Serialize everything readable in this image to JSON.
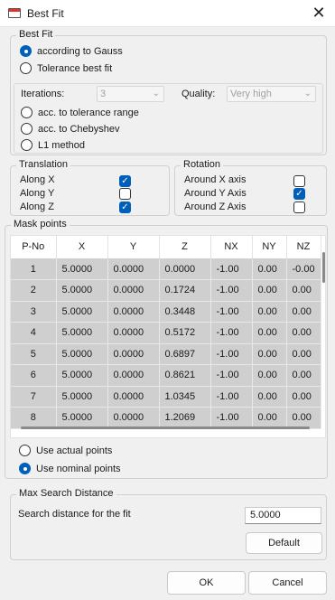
{
  "window": {
    "title": "Best Fit",
    "close_glyph": "✕"
  },
  "best_fit": {
    "label": "Best Fit",
    "gauss": "according to Gauss",
    "tolerance": "Tolerance best fit",
    "iterations_label": "Iterations:",
    "iterations_value": "3",
    "quality_label": "Quality:",
    "quality_value": "Very high",
    "tol_range": "acc. to tolerance range",
    "chebyshev": "acc. to Chebyshev",
    "l1": "L1 method",
    "selected": "according to Gauss"
  },
  "translation": {
    "label": "Translation",
    "items": [
      {
        "label": "Along X",
        "checked": true
      },
      {
        "label": "Along Y",
        "checked": false
      },
      {
        "label": "Along Z",
        "checked": true
      }
    ]
  },
  "rotation": {
    "label": "Rotation",
    "items": [
      {
        "label": "Around X axis",
        "checked": false
      },
      {
        "label": "Around Y Axis",
        "checked": true
      },
      {
        "label": "Around Z Axis",
        "checked": false
      }
    ]
  },
  "mask": {
    "label": "Mask points",
    "columns": [
      "P-No",
      "X",
      "Y",
      "Z",
      "NX",
      "NY",
      "NZ"
    ],
    "rows": [
      [
        "1",
        "5.0000",
        "0.0000",
        "0.0000",
        "-1.00",
        "0.00",
        "-0.00"
      ],
      [
        "2",
        "5.0000",
        "0.0000",
        "0.1724",
        "-1.00",
        "0.00",
        "0.00"
      ],
      [
        "3",
        "5.0000",
        "0.0000",
        "0.3448",
        "-1.00",
        "0.00",
        "0.00"
      ],
      [
        "4",
        "5.0000",
        "0.0000",
        "0.5172",
        "-1.00",
        "0.00",
        "0.00"
      ],
      [
        "5",
        "5.0000",
        "0.0000",
        "0.6897",
        "-1.00",
        "0.00",
        "0.00"
      ],
      [
        "6",
        "5.0000",
        "0.0000",
        "0.8621",
        "-1.00",
        "0.00",
        "0.00"
      ],
      [
        "7",
        "5.0000",
        "0.0000",
        "1.0345",
        "-1.00",
        "0.00",
        "0.00"
      ],
      [
        "8",
        "5.0000",
        "0.0000",
        "1.2069",
        "-1.00",
        "0.00",
        "0.00"
      ]
    ],
    "use_actual": "Use actual points",
    "use_nominal": "Use nominal points",
    "selected": "Use nominal points"
  },
  "search": {
    "label": "Max Search Distance",
    "field_label": "Search distance for the fit",
    "value": "5.0000",
    "default_button": "Default"
  },
  "footer": {
    "ok": "OK",
    "cancel": "Cancel"
  },
  "colors": {
    "accent": "#005fb8",
    "selected_row_bg": "#cfcfcf",
    "dialog_bg": "#f0f0f0"
  }
}
